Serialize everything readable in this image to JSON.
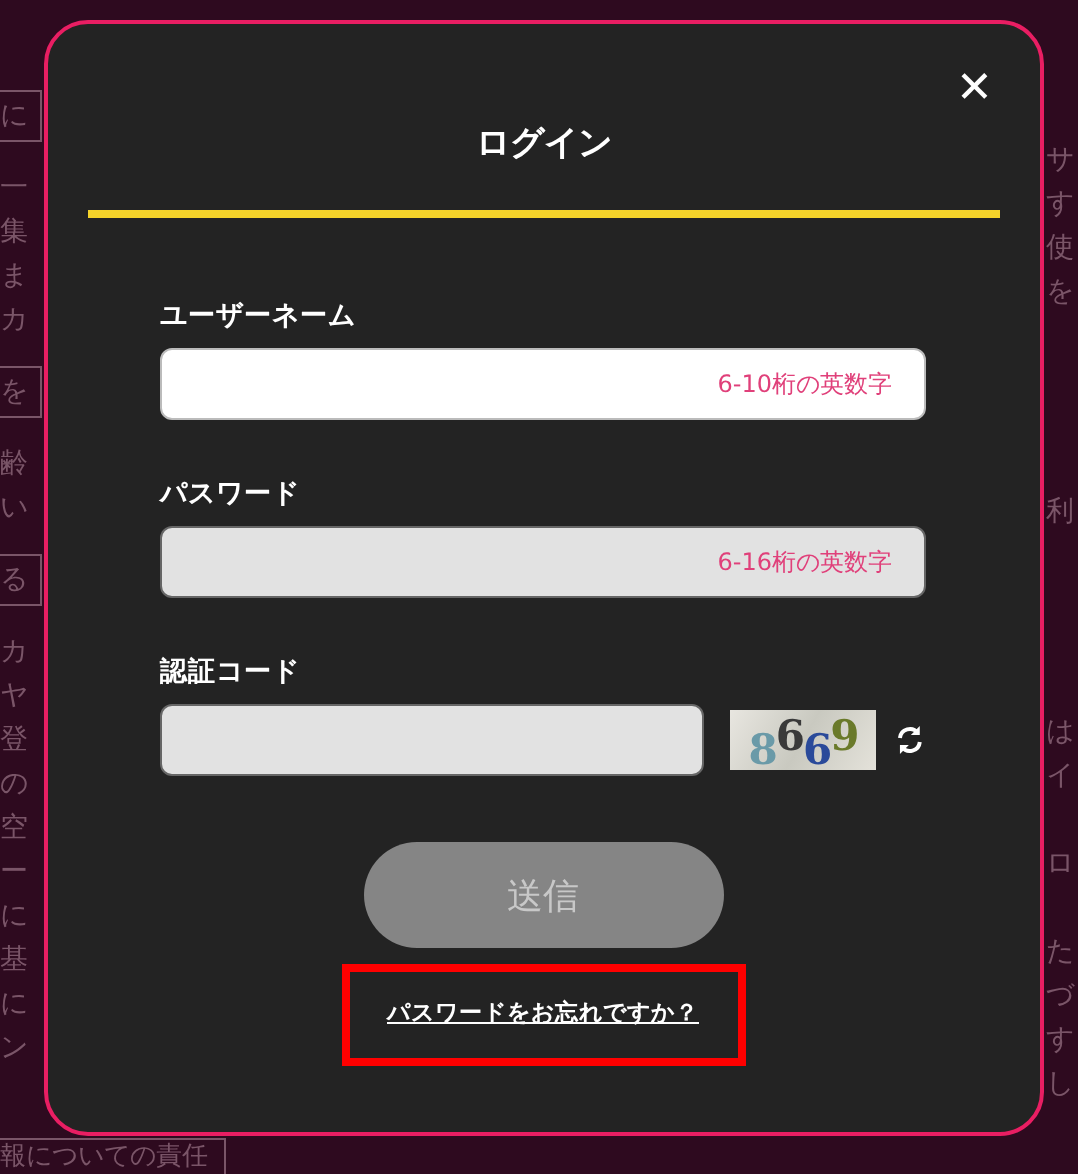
{
  "background": {
    "left": [
      {
        "kind": "boxed",
        "text": "に"
      },
      {
        "kind": "line",
        "text": "一"
      },
      {
        "kind": "line",
        "text": "集"
      },
      {
        "kind": "line",
        "text": "ま"
      },
      {
        "kind": "line",
        "text": "カ"
      },
      {
        "kind": "boxed",
        "text": "を"
      },
      {
        "kind": "line",
        "text": "齢"
      },
      {
        "kind": "line",
        "text": "い"
      },
      {
        "kind": "boxed",
        "text": "る"
      },
      {
        "kind": "line",
        "text": "カ"
      },
      {
        "kind": "line",
        "text": "ヤ"
      },
      {
        "kind": "line",
        "text": "登"
      },
      {
        "kind": "line",
        "text": "の"
      },
      {
        "kind": "line",
        "text": "空"
      },
      {
        "kind": "line",
        "text": "ー"
      },
      {
        "kind": "line",
        "text": "に"
      },
      {
        "kind": "line",
        "text": "基"
      },
      {
        "kind": "line",
        "text": "に"
      },
      {
        "kind": "line",
        "text": "ン"
      },
      {
        "kind": "footer",
        "text": "報についての責任"
      }
    ],
    "right": [
      {
        "kind": "line",
        "text": "サ"
      },
      {
        "kind": "line",
        "text": "す"
      },
      {
        "kind": "line",
        "text": "使"
      },
      {
        "kind": "line",
        "text": "を"
      },
      {
        "kind": "gap"
      },
      {
        "kind": "gap"
      },
      {
        "kind": "gap"
      },
      {
        "kind": "gap"
      },
      {
        "kind": "line",
        "text": "利"
      },
      {
        "kind": "gap"
      },
      {
        "kind": "gap"
      },
      {
        "kind": "gap"
      },
      {
        "kind": "gap"
      },
      {
        "kind": "line",
        "text": "は"
      },
      {
        "kind": "line",
        "text": "イ"
      },
      {
        "kind": "gap"
      },
      {
        "kind": "line",
        "text": "ロ"
      },
      {
        "kind": "gap"
      },
      {
        "kind": "line",
        "text": "た"
      },
      {
        "kind": "line",
        "text": "づ"
      },
      {
        "kind": "line",
        "text": "す"
      },
      {
        "kind": "line",
        "text": "し"
      }
    ]
  },
  "dialog": {
    "title": "ログイン",
    "close": "✕",
    "fields": [
      {
        "kind": "text",
        "label": "ユーザーネーム",
        "placeholder": "6-10桁の英数字",
        "focused": true
      },
      {
        "kind": "text",
        "label": "パスワード",
        "placeholder": "6-16桁の英数字",
        "focused": false
      },
      {
        "kind": "captcha",
        "label": "認証コード",
        "focused": false,
        "captcha": "8669"
      }
    ],
    "submit": {
      "label": "送信",
      "disabled": true
    },
    "forgot_link": {
      "label": "パスワードをお忘れですか？",
      "highlighted": true
    }
  }
}
